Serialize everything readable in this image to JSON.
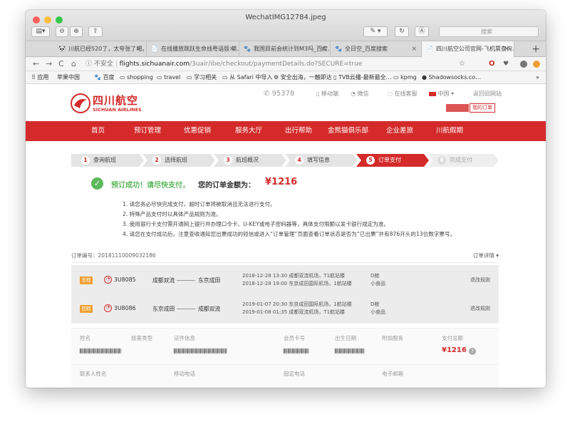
{
  "window": {
    "title": "WechatIMG12784.jpeg",
    "search_placeholder": "搜索"
  },
  "tabs": [
    {
      "label": "川航已经520了，太夸张了吧。",
      "icon": "🐼"
    },
    {
      "label": "在线播放跳跃生命线粤语版 第…",
      "icon": "📄"
    },
    {
      "label": "我国目前会统计到M3吗_百度…",
      "icon": "🐾"
    },
    {
      "label": "全日空_百度搜索",
      "icon": "🐾"
    },
    {
      "label": "四川航空公司官网-飞机票查询…",
      "icon": "📄"
    }
  ],
  "address": {
    "security": "不安全",
    "url_host": "flights.sichuanair.com",
    "url_path": "/3uair/ibe/checkout/paymentDetails.do?SECURE=true"
  },
  "bookmarks": [
    "应用",
    "苹果中国",
    "百度",
    "shopping",
    "travel",
    "学习相关",
    "从 Safari 中导入",
    "安全出海，一触即达",
    "TVB云播-最新最全…",
    "kpmg",
    "Shadowsocks.co…"
  ],
  "header": {
    "logo_cn": "四川航空",
    "logo_en": "SICHUAN AIRLINES",
    "hotline": "95378",
    "links": [
      "移动端",
      "微信",
      "在线客服",
      "中国",
      "返回旧网站"
    ],
    "my_orders": "我的订单"
  },
  "nav": [
    "首页",
    "预订管理",
    "优惠促销",
    "服务大厅",
    "出行帮助",
    "金熊猫俱乐部",
    "企业差旅",
    "川航假期"
  ],
  "steps": [
    {
      "num": "1",
      "label": "查询航班"
    },
    {
      "num": "2",
      "label": "选择航班"
    },
    {
      "num": "3",
      "label": "航班概况"
    },
    {
      "num": "4",
      "label": "填写信息"
    },
    {
      "num": "5",
      "label": "订单支付"
    },
    {
      "num": "6",
      "label": "完成支付"
    }
  ],
  "status": {
    "success": "预订成功！请尽快支付，",
    "amount_label": "您的订单金额为：",
    "amount": "¥1216"
  },
  "notes": [
    "1. 请您务必尽快完成支付，超时订单将被取消且无法进行支付。",
    "2. 特殊产品支付时以具体产品规则为准。",
    "3. 使用银行卡支付需开通网上银行并办理口令卡、U-KEY或电子密码器等，具体支付限额以发卡银行规定为准。",
    "4. 请您在支付成功后，注意查收通知您出票成功的短信或进入“订单管理”页面查看订单状态是否为“已出票”并有876开头的13位数字票号。"
  ],
  "order": {
    "number_label": "订单编号：",
    "number": "20181110009032186",
    "detail_label": "订单详情"
  },
  "flights": [
    {
      "tag": "去程",
      "flight_no": "3U8085",
      "from": "成都双流",
      "to": "东京成田",
      "dep": "2018-12-28  13:30  成都双流机场，T1航站楼",
      "arr": "2018-12-28  19:00  东京成田国际机场，1航站楼",
      "cabin": "D舱",
      "meal": "小食品",
      "rule": "退改规则"
    },
    {
      "tag": "回程",
      "flight_no": "3U8086",
      "from": "东京成田",
      "to": "成都双流",
      "dep": "2019-01-07  20:30  东京成田国际机场，1航站楼",
      "arr": "2019-01-08  01:35  成都双流机场，T1航站楼",
      "cabin": "D舱",
      "meal": "小食品",
      "rule": "退改规则"
    }
  ],
  "passenger": {
    "headers": [
      "姓名",
      "旅客类型",
      "证件信息",
      "会员卡号",
      "出生日期",
      "附加服务",
      "支付总额"
    ],
    "total": "¥1216",
    "contact_headers": [
      "联系人姓名",
      "移动电话",
      "固定电话",
      "电子邮箱"
    ]
  },
  "colors": {
    "brand_red": "#d42a2a",
    "success_green": "#5cb85c",
    "tag_orange": "#f0a033"
  }
}
